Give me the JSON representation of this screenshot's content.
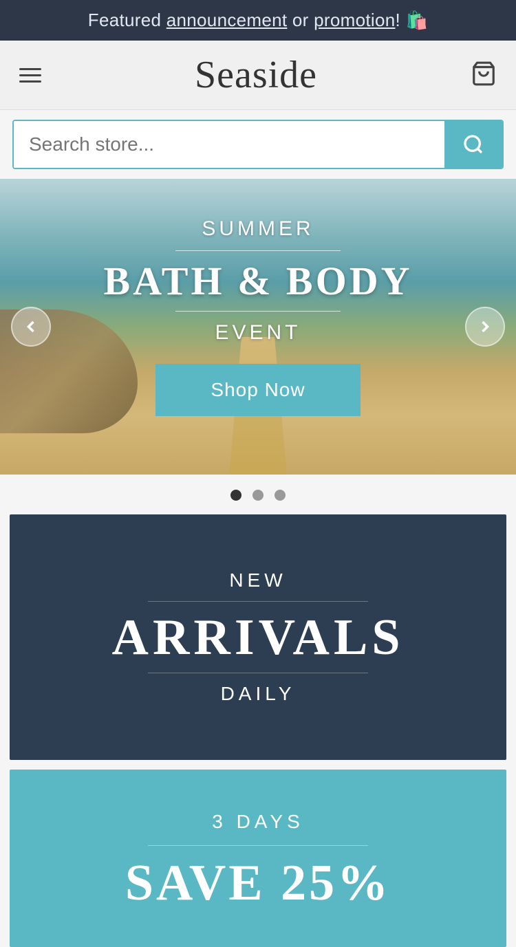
{
  "announcement": {
    "text_before": "Featured ",
    "link1": "announcement",
    "text_middle": " or ",
    "link2": "promotion",
    "text_after": "! 🛍️"
  },
  "header": {
    "logo": "Seaside"
  },
  "search": {
    "placeholder": "Search store..."
  },
  "hero": {
    "line1": "SUMMER",
    "line2": "BATH & BODY",
    "line3": "EVENT",
    "button_label": "Shop Now"
  },
  "carousel": {
    "dots": [
      {
        "active": true
      },
      {
        "active": false
      },
      {
        "active": false
      }
    ]
  },
  "new_arrivals": {
    "label_top": "NEW",
    "title": "ARRIVALS",
    "label_bottom": "DAILY"
  },
  "save_section": {
    "label_top": "3 DAYS",
    "title": "SAVE 25%"
  }
}
